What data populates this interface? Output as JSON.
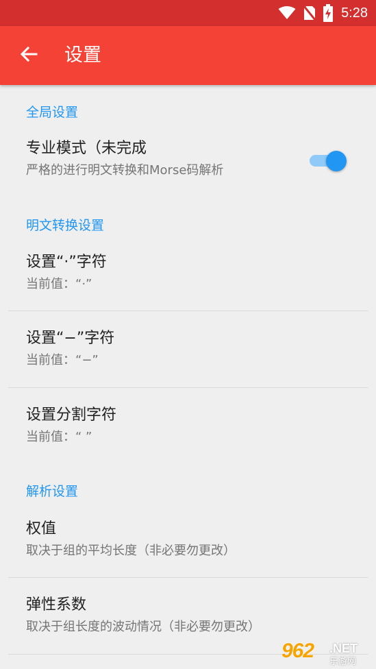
{
  "status_bar": {
    "time": "5:28",
    "icons": [
      "wifi-icon",
      "no-sim-icon",
      "battery-charging-icon"
    ]
  },
  "app_bar": {
    "back_icon": "arrow-back-icon",
    "title": "设置"
  },
  "sections": [
    {
      "header": "全局设置",
      "items": [
        {
          "title": "专业模式（未完成",
          "summary": "严格的进行明文转换和Morse码解析",
          "switch_on": true
        }
      ]
    },
    {
      "header": "明文转换设置",
      "items": [
        {
          "title": "设置“·”字符",
          "summary": "当前值：“·”"
        },
        {
          "title": "设置“−”字符",
          "summary": "当前值：“−”"
        },
        {
          "title": "设置分割字符",
          "summary": "当前值：“ ”"
        }
      ]
    },
    {
      "header": "解析设置",
      "items": [
        {
          "title": "权值",
          "summary": "取决于组的平均长度（非必要勿更改）"
        },
        {
          "title": "弹性系数",
          "summary": "取决于组长度的波动情况（非必要勿更改）"
        }
      ]
    }
  ],
  "watermark": {
    "number": "962",
    "domain": ".NET",
    "site_name": "乐游网"
  },
  "colors": {
    "status_bar": "#d32f2f",
    "app_bar": "#f44336",
    "accent": "#2196f3",
    "background": "#efefef"
  }
}
